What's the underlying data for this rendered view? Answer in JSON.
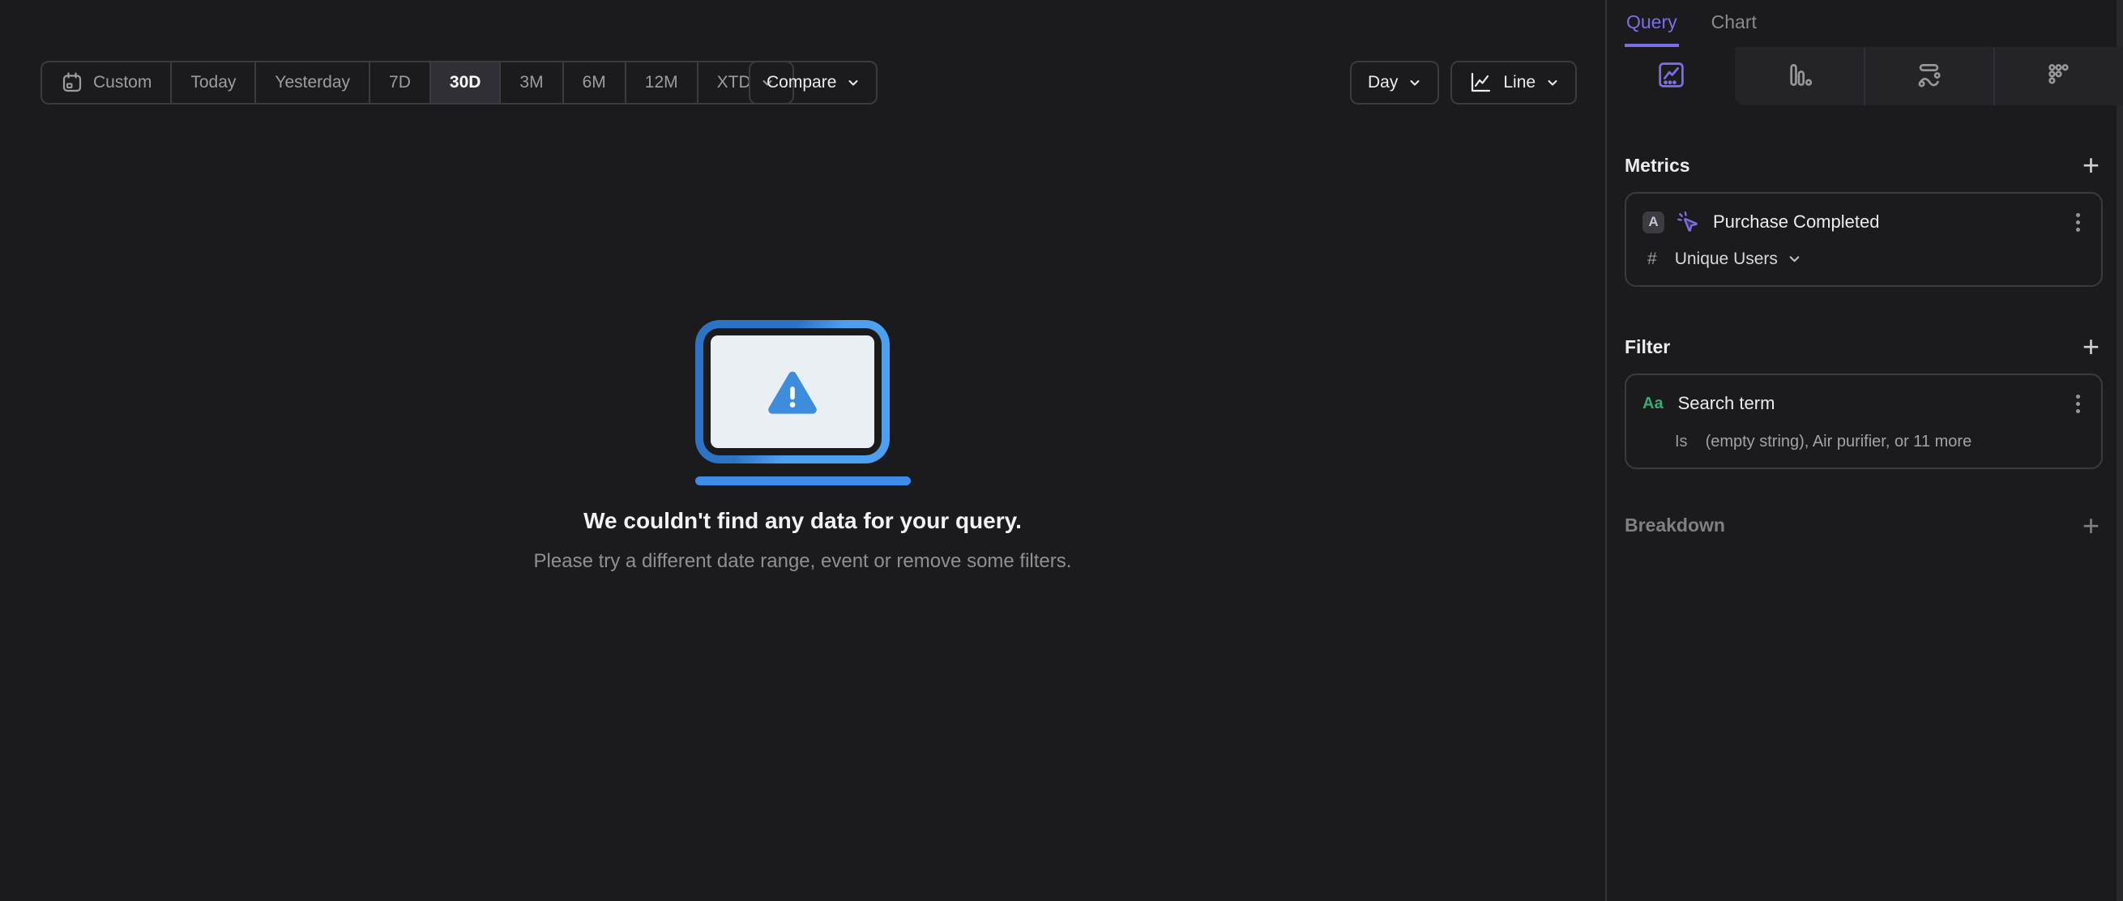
{
  "toolbar": {
    "date_ranges": [
      {
        "label": "Custom",
        "selected": false,
        "icon": "calendar-icon"
      },
      {
        "label": "Today",
        "selected": false
      },
      {
        "label": "Yesterday",
        "selected": false
      },
      {
        "label": "7D",
        "selected": false
      },
      {
        "label": "30D",
        "selected": true
      },
      {
        "label": "3M",
        "selected": false
      },
      {
        "label": "6M",
        "selected": false
      },
      {
        "label": "12M",
        "selected": false
      },
      {
        "label": "XTD",
        "selected": false,
        "chevron": true
      }
    ],
    "compare_label": "Compare",
    "granularity_label": "Day",
    "chart_type_label": "Line"
  },
  "empty_state": {
    "title": "We couldn't find any data for your query.",
    "subtitle": "Please try a different date range, event or remove some filters."
  },
  "sidebar": {
    "tabs": [
      {
        "label": "Query",
        "active": true
      },
      {
        "label": "Chart",
        "active": false
      }
    ],
    "view_tabs": [
      {
        "icon": "insights-line-icon",
        "active": true
      },
      {
        "icon": "bar-chart-icon",
        "active": false
      },
      {
        "icon": "flows-icon",
        "active": false
      },
      {
        "icon": "retention-grid-icon",
        "active": false
      }
    ],
    "metrics": {
      "heading": "Metrics",
      "add_label": "+",
      "items": [
        {
          "letter": "A",
          "name": "Purchase Completed",
          "aggregation_symbol": "#",
          "aggregation": "Unique Users"
        }
      ]
    },
    "filter": {
      "heading": "Filter",
      "add_label": "+",
      "items": [
        {
          "type_label": "Aa",
          "name": "Search term",
          "operator": "Is",
          "value": "(empty string), Air purifier, or 11 more"
        }
      ]
    },
    "breakdown": {
      "heading": "Breakdown",
      "add_label": "+"
    }
  },
  "colors": {
    "accent_purple": "#7b6fe8",
    "string_green": "#3aa976",
    "illustration_blue_dark": "#2d73c5",
    "illustration_blue_light": "#4d9ff0",
    "warning_blue": "#3e8cdc",
    "background": "#1b1b1e",
    "selected_range_bg": "#2f2f35"
  }
}
